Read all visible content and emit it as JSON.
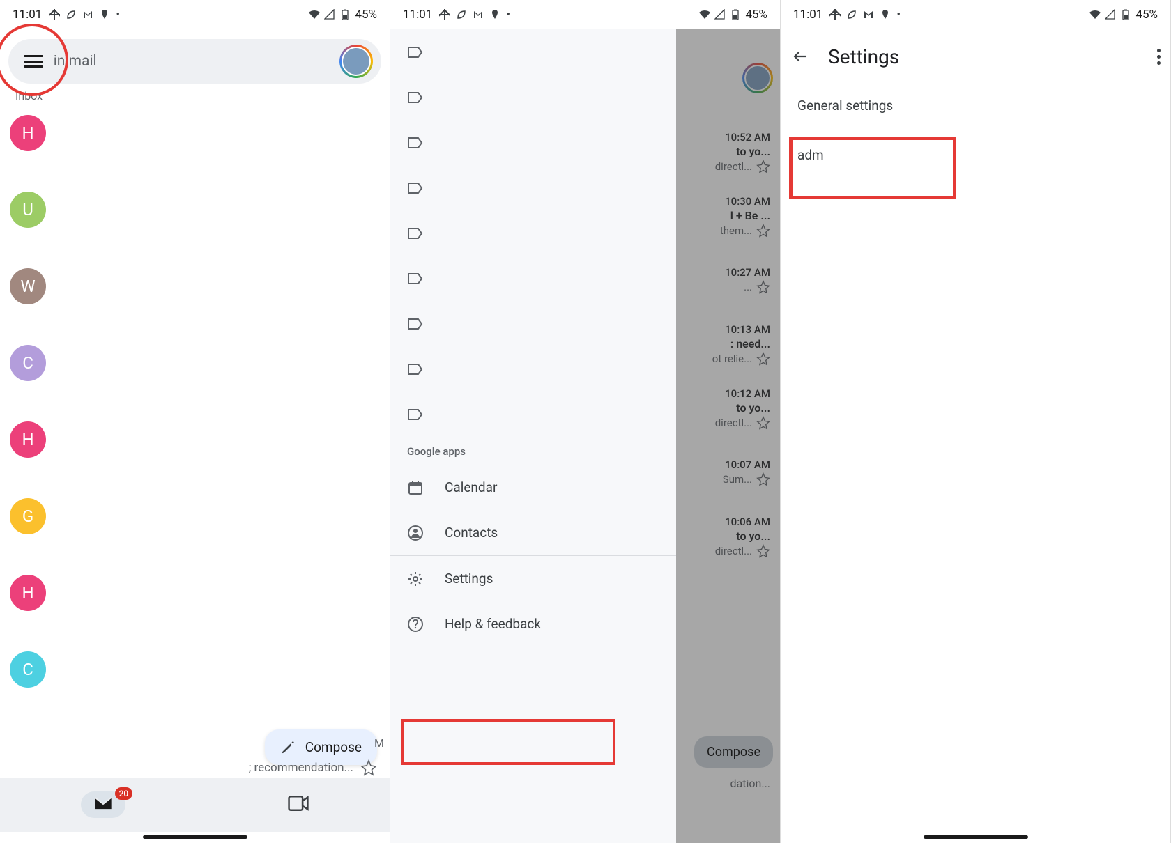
{
  "status": {
    "time": "11:01",
    "battery": "45%"
  },
  "screen1": {
    "search_placeholder": "Search in mail",
    "inbox_label": "Inbox",
    "compose": "Compose",
    "mail_badge": "20",
    "snippet_tail": "; recommendation...",
    "trailing_letter": "M",
    "avatars": [
      {
        "letter": "H",
        "color": "#ec407a"
      },
      {
        "letter": "U",
        "color": "#9ccc65"
      },
      {
        "letter": "W",
        "color": "#a1887f"
      },
      {
        "letter": "C",
        "color": "#b39ddb"
      },
      {
        "letter": "H",
        "color": "#ec407a"
      },
      {
        "letter": "G",
        "color": "#fbc02d"
      },
      {
        "letter": "H",
        "color": "#ec407a"
      },
      {
        "letter": "C",
        "color": "#4dd0e1"
      }
    ]
  },
  "screen2": {
    "section_label": "Google apps",
    "apps": {
      "calendar": "Calendar",
      "contacts": "Contacts"
    },
    "settings": "Settings",
    "help": "Help & feedback",
    "compose": "Compose",
    "peek_snippet_tail": "dation...",
    "peek": [
      {
        "time": "10:52 AM",
        "subj": "to yo...",
        "snip": "directl..."
      },
      {
        "time": "10:30 AM",
        "subj": "l + Be ...",
        "snip": "them..."
      },
      {
        "time": "10:27 AM",
        "subj": "",
        "snip": "..."
      },
      {
        "time": "10:13 AM",
        "subj": ": need...",
        "snip": "ot relie..."
      },
      {
        "time": "10:12 AM",
        "subj": "to yo...",
        "snip": "directl..."
      },
      {
        "time": "10:07 AM",
        "subj": "",
        "snip": "Sum..."
      },
      {
        "time": "10:06 AM",
        "subj": "to yo...",
        "snip": "directl..."
      }
    ]
  },
  "screen3": {
    "title": "Settings",
    "general": "General settings",
    "account": "adm"
  }
}
